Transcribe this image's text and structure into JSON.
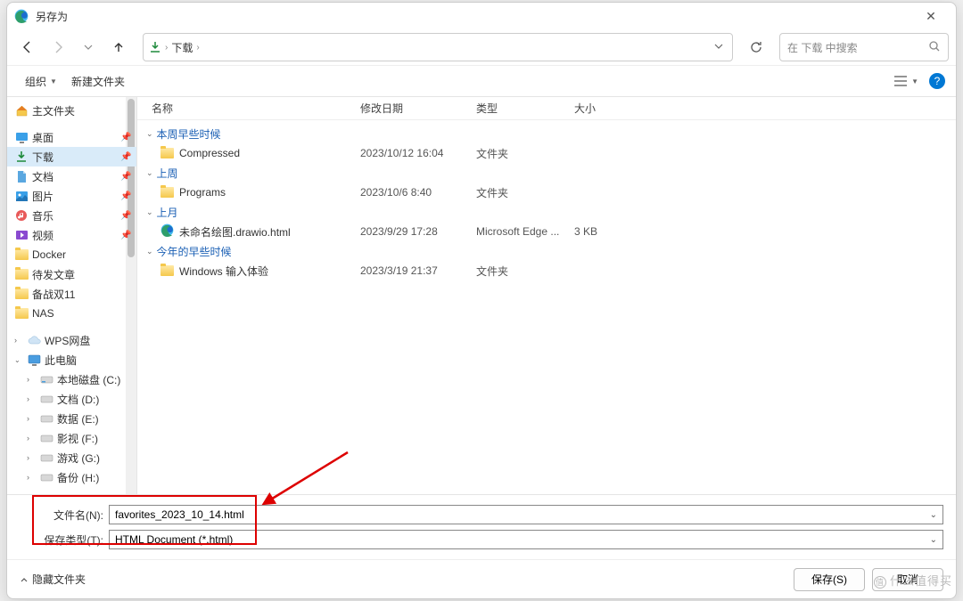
{
  "title": "另存为",
  "address": {
    "location": "下载"
  },
  "search": {
    "placeholder": "在 下载 中搜索"
  },
  "toolbar": {
    "organize": "组织",
    "newfolder": "新建文件夹"
  },
  "sidebar": {
    "home": "主文件夹",
    "quick": [
      {
        "label": "桌面",
        "pinned": true,
        "icon": "desktop"
      },
      {
        "label": "下载",
        "pinned": true,
        "icon": "download",
        "selected": true
      },
      {
        "label": "文档",
        "pinned": true,
        "icon": "documents"
      },
      {
        "label": "图片",
        "pinned": true,
        "icon": "pictures"
      },
      {
        "label": "音乐",
        "pinned": true,
        "icon": "music"
      },
      {
        "label": "视频",
        "pinned": true,
        "icon": "videos"
      },
      {
        "label": "Docker",
        "pinned": false,
        "icon": "folder"
      },
      {
        "label": "待发文章",
        "pinned": false,
        "icon": "folder"
      },
      {
        "label": "备战双11",
        "pinned": false,
        "icon": "folder"
      },
      {
        "label": "NAS",
        "pinned": false,
        "icon": "folder"
      }
    ],
    "wps": "WPS网盘",
    "thispc": "此电脑",
    "drives": [
      {
        "label": "本地磁盘 (C:)"
      },
      {
        "label": "文档 (D:)"
      },
      {
        "label": "数据 (E:)"
      },
      {
        "label": "影视 (F:)"
      },
      {
        "label": "游戏 (G:)"
      },
      {
        "label": "备份 (H:)"
      }
    ]
  },
  "headers": {
    "name": "名称",
    "date": "修改日期",
    "type": "类型",
    "size": "大小"
  },
  "groups": [
    {
      "label": "本周早些时候",
      "items": [
        {
          "name": "Compressed",
          "date": "2023/10/12 16:04",
          "type": "文件夹",
          "size": "",
          "icon": "folder"
        }
      ]
    },
    {
      "label": "上周",
      "items": [
        {
          "name": "Programs",
          "date": "2023/10/6 8:40",
          "type": "文件夹",
          "size": "",
          "icon": "folder"
        }
      ]
    },
    {
      "label": "上月",
      "items": [
        {
          "name": "未命名绘图.drawio.html",
          "date": "2023/9/29 17:28",
          "type": "Microsoft Edge ...",
          "size": "3 KB",
          "icon": "edge"
        }
      ]
    },
    {
      "label": "今年的早些时候",
      "items": [
        {
          "name": "Windows 输入体验",
          "date": "2023/3/19 21:37",
          "type": "文件夹",
          "size": "",
          "icon": "folder"
        }
      ]
    }
  ],
  "filename": {
    "label": "文件名(N):",
    "value": "favorites_2023_10_14.html"
  },
  "filetype": {
    "label": "保存类型(T):",
    "value": "HTML Document (*.html)"
  },
  "footer": {
    "hide": "隐藏文件夹",
    "save": "保存(S)",
    "cancel": "取消"
  },
  "watermark": "什么值得买"
}
